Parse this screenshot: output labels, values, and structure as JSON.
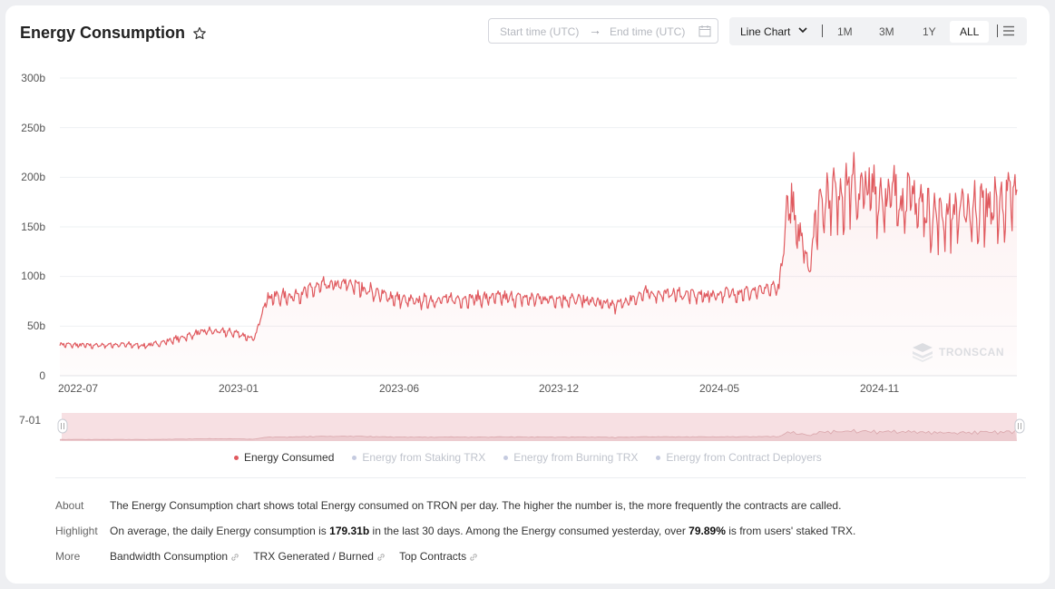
{
  "header": {
    "title": "Energy Consumption",
    "favorite_icon": "star-icon"
  },
  "date_range": {
    "start_placeholder": "Start time (UTC)",
    "end_placeholder": "End time (UTC)",
    "separator_icon": "arrow-right-icon",
    "calendar_icon": "calendar-icon"
  },
  "toolbar": {
    "chart_type": "Line Chart",
    "periods": [
      "1M",
      "3M",
      "1Y",
      "ALL"
    ],
    "active_period": "ALL",
    "menu_icon": "hamburger-menu-icon"
  },
  "watermark": "TRONSCAN",
  "zoom_start_label": "7-01",
  "chart_data": {
    "type": "area",
    "title": "",
    "xlabel": "",
    "ylabel": "",
    "y_ticks": [
      "300b",
      "250b",
      "200b",
      "150b",
      "100b",
      "50b",
      "0"
    ],
    "ylim": [
      0,
      300
    ],
    "x_ticks": [
      "2022-07",
      "2023-01",
      "2023-06",
      "2023-12",
      "2024-05",
      "2024-11"
    ],
    "unit": "billion",
    "grid": true,
    "legend_position": "bottom",
    "series": [
      {
        "name": "Energy Consumed",
        "color": "#e05a5f",
        "visible": true,
        "points": [
          [
            "2022-07",
            32
          ],
          [
            "2022-08",
            31
          ],
          [
            "2022-09",
            32
          ],
          [
            "2022-10",
            31
          ],
          [
            "2022-11",
            38
          ],
          [
            "2022-12",
            46
          ],
          [
            "2023-01",
            44
          ],
          [
            "2023-01-20",
            37
          ],
          [
            "2023-02",
            80
          ],
          [
            "2023-03",
            82
          ],
          [
            "2023-04",
            92
          ],
          [
            "2023-05",
            94
          ],
          [
            "2023-06",
            83
          ],
          [
            "2023-07",
            76
          ],
          [
            "2023-08",
            78
          ],
          [
            "2023-09",
            79
          ],
          [
            "2023-10",
            80
          ],
          [
            "2023-11",
            79
          ],
          [
            "2023-12",
            79
          ],
          [
            "2024-01",
            77
          ],
          [
            "2024-02",
            72
          ],
          [
            "2024-03",
            84
          ],
          [
            "2024-04",
            84
          ],
          [
            "2024-05",
            82
          ],
          [
            "2024-06",
            85
          ],
          [
            "2024-07",
            86
          ],
          [
            "2024-07-20",
            92
          ],
          [
            "2024-08",
            190
          ],
          [
            "2024-08-20",
            110
          ],
          [
            "2024-09",
            185
          ],
          [
            "2024-10",
            195
          ],
          [
            "2024-11",
            188
          ],
          [
            "2024-12",
            185
          ],
          [
            "2025-01",
            165
          ],
          [
            "2025-02",
            172
          ],
          [
            "2025-03",
            175
          ],
          [
            "2025-03-20",
            182
          ]
        ]
      },
      {
        "name": "Energy from Staking TRX",
        "color": "#c5cbe0",
        "visible": false
      },
      {
        "name": "Energy from Burning TRX",
        "color": "#c5cbe0",
        "visible": false
      },
      {
        "name": "Energy from Contract Deployers",
        "color": "#c5cbe0",
        "visible": false
      }
    ]
  },
  "info": {
    "about_label": "About",
    "about_text": "The Energy Consumption chart shows total Energy consumed on TRON per day. The higher the number is, the more frequently the contracts are called.",
    "highlight_label": "Highlight",
    "highlight_pre": "On average, the daily Energy consumption is ",
    "highlight_value1": "179.31b",
    "highlight_mid": " in the last 30 days.  Among the Energy consumed yesterday, over ",
    "highlight_value2": "79.89%",
    "highlight_post": " is from users' staked TRX.",
    "more_label": "More",
    "links": [
      "Bandwidth Consumption",
      "TRX Generated / Burned",
      "Top Contracts"
    ],
    "link_icon": "link-icon"
  }
}
